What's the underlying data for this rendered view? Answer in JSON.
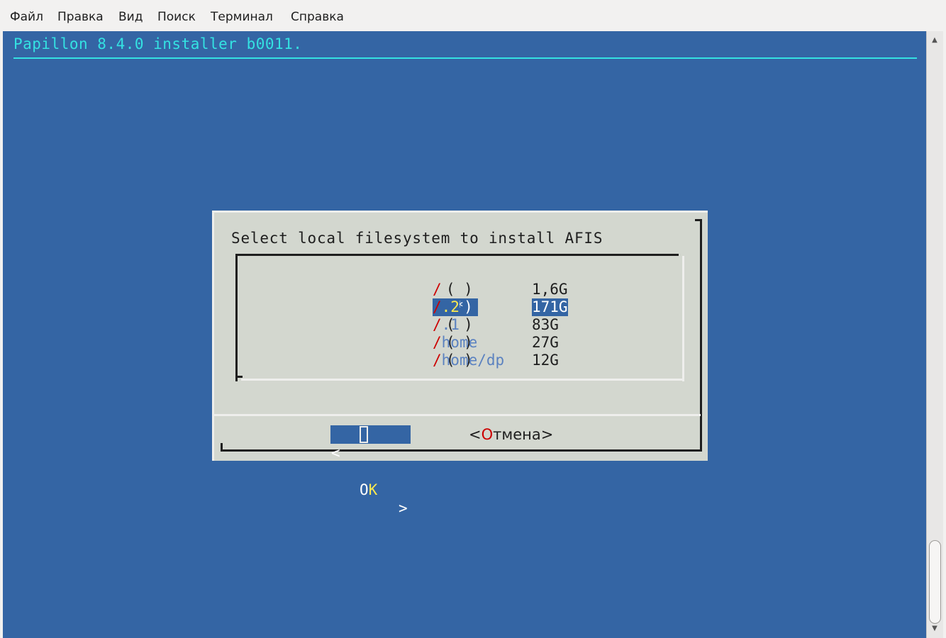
{
  "menubar": {
    "items": [
      {
        "label": "Файл"
      },
      {
        "label": "Правка"
      },
      {
        "label": "Вид"
      },
      {
        "label": "Поиск"
      },
      {
        "label": "Терминал"
      },
      {
        "label": "Справка"
      }
    ]
  },
  "terminal": {
    "title": "Papillon 8.4.0 installer b0011.",
    "colors": {
      "background": "#3465a4",
      "title": "#34e2e2",
      "dialog": "#d3d7cf",
      "selection": "#3465a4",
      "hotkey": "#cc0000",
      "highlight": "#fce94f"
    }
  },
  "dialog": {
    "title": "Select local filesystem to install AFIS",
    "filesystems": [
      {
        "radio": "( )",
        "slash": "/",
        "rest": "",
        "size": "1,6G",
        "selected": false
      },
      {
        "radio": "(*)",
        "slash": "/",
        "rest": ".2",
        "size": "171G",
        "selected": true
      },
      {
        "radio": "( )",
        "slash": "/",
        "rest": ".1",
        "size": "83G",
        "selected": false
      },
      {
        "radio": "( )",
        "slash": "/",
        "rest": "home",
        "size": "27G",
        "selected": false
      },
      {
        "radio": "( )",
        "slash": "/",
        "rest": "home/dp",
        "size": "12G",
        "selected": false
      }
    ],
    "ok_button": {
      "left": "<",
      "hotkey": "O",
      "rest": "K",
      "right": ">"
    },
    "cancel_button": {
      "open": "<",
      "hotkey": "О",
      "rest": "тмена",
      "close": ">"
    }
  },
  "scrollbar": {
    "up_icon": "arrow-up-icon",
    "down_icon": "arrow-down-icon"
  }
}
